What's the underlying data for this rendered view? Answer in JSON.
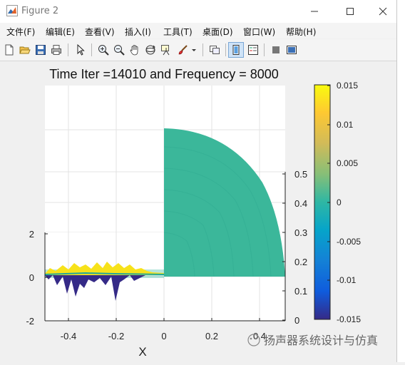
{
  "window": {
    "title": "Figure 2",
    "controls": {
      "minimize_icon": "minimize-icon",
      "maximize_icon": "maximize-icon",
      "close_icon": "close-icon"
    }
  },
  "menu": [
    {
      "label": "文件(F)"
    },
    {
      "label": "编辑(E)"
    },
    {
      "label": "查看(V)"
    },
    {
      "label": "插入(I)"
    },
    {
      "label": "工具(T)"
    },
    {
      "label": "桌面(D)"
    },
    {
      "label": "窗口(W)"
    },
    {
      "label": "帮助(H)"
    }
  ],
  "toolbar": [
    {
      "icon": "new-figure-icon"
    },
    {
      "icon": "open-file-icon"
    },
    {
      "icon": "save-icon"
    },
    {
      "icon": "print-icon"
    },
    {
      "icon": "select-arrow-icon"
    },
    {
      "icon": "zoom-in-icon"
    },
    {
      "icon": "zoom-out-icon"
    },
    {
      "icon": "pan-hand-icon"
    },
    {
      "icon": "rotate-3d-icon"
    },
    {
      "icon": "data-cursor-icon"
    },
    {
      "icon": "brush-icon"
    },
    {
      "icon": "link-plot-icon"
    },
    {
      "icon": "colorbar-icon"
    },
    {
      "icon": "legend-icon"
    },
    {
      "icon": "hide-plot-tools-icon"
    },
    {
      "icon": "show-plot-tools-icon"
    }
  ],
  "figure": {
    "title": "Time Iter =14010 and Frequency = 8000",
    "xlabel": "X",
    "x_ticks": [
      "-0.4",
      "-0.2",
      "0",
      "0.2",
      "0.4"
    ],
    "left_y_ticks": [
      "2",
      "0",
      "-2"
    ],
    "right_y_ticks": [
      "0.5",
      "0.4",
      "0.3",
      "0.2",
      "0.1",
      "0"
    ],
    "colorbar": {
      "ticks": [
        "0.015",
        "0.01",
        "0.005",
        "0",
        "-0.005",
        "-0.01",
        "-0.015"
      ],
      "range": [
        -0.015,
        0.015
      ],
      "colormap": "parula"
    }
  },
  "chart_data": {
    "type": "heatmap",
    "title": "Time Iter =14010 and Frequency = 8000",
    "xlabel": "X",
    "xlim": [
      -0.5,
      0.5
    ],
    "x_ticks": [
      -0.4,
      -0.2,
      0,
      0.2,
      0.4
    ],
    "y_right_lim": [
      0,
      0.55
    ],
    "y_right_ticks": [
      0,
      0.1,
      0.2,
      0.3,
      0.4,
      0.5
    ],
    "y_left_lim": [
      -2,
      2
    ],
    "y_left_ticks": [
      -2,
      0,
      2
    ],
    "color_range": [
      -0.015,
      0.015
    ],
    "colorbar_ticks": [
      0.015,
      0.01,
      0.005,
      0,
      -0.005,
      -0.01,
      -0.015
    ],
    "grid": true,
    "quarter_disk_field": {
      "radius": 0.5,
      "value": 0.0
    }
  },
  "watermark": "扬声器系统设计与仿真"
}
